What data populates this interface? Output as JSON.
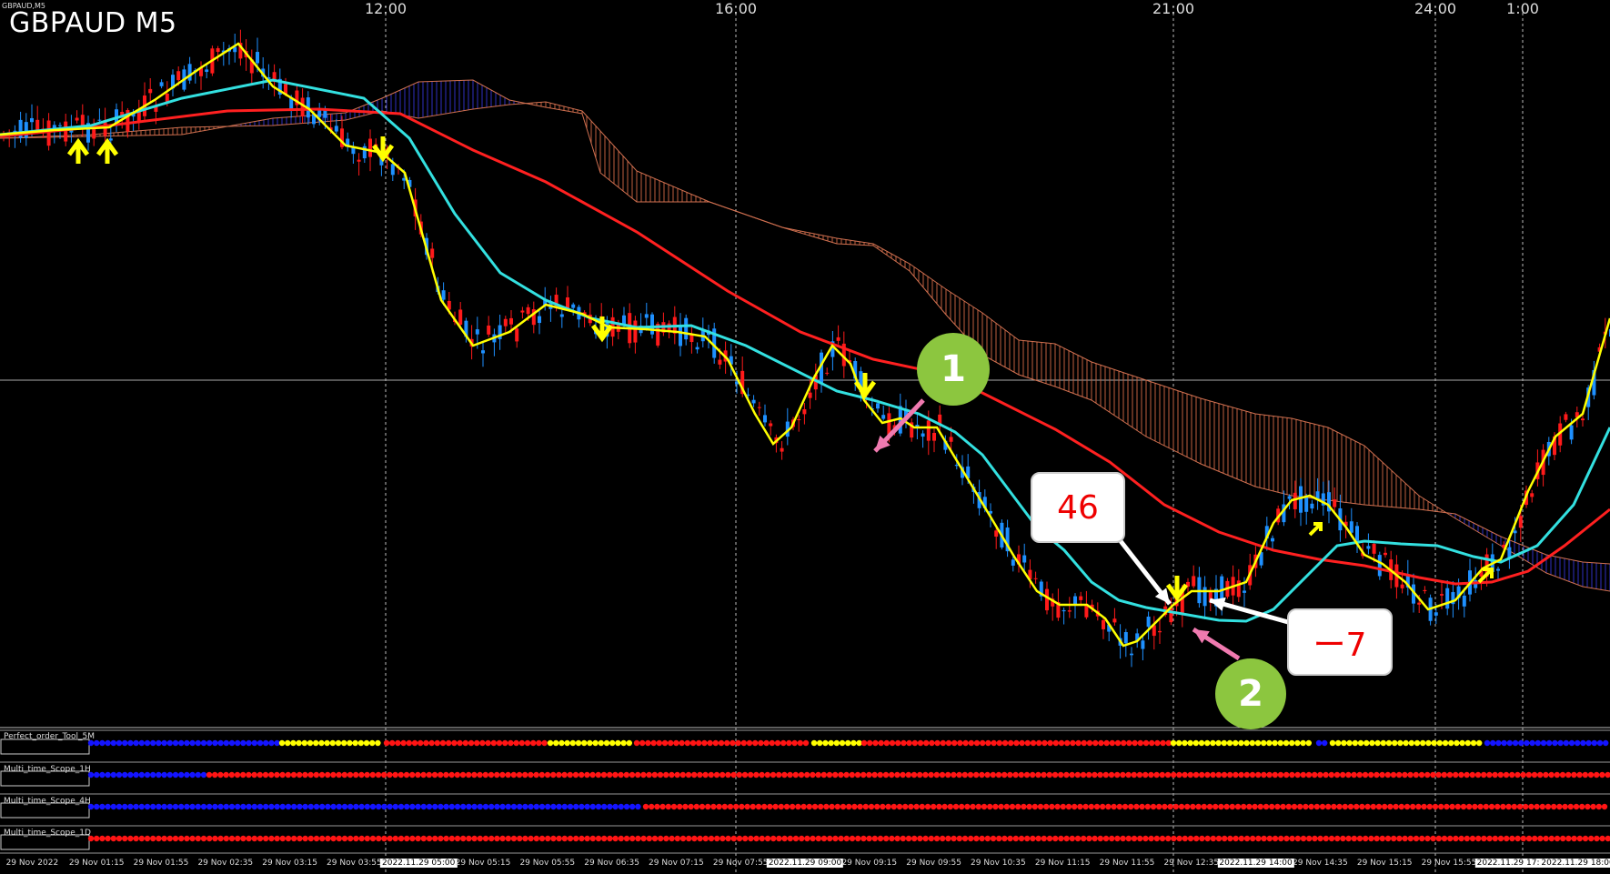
{
  "header": {
    "title": "GBPAUD M5",
    "small_title": "GBPAUD,M5"
  },
  "time_axis": [
    "12:00",
    "16:00",
    "21:00",
    "24:00",
    "1:00"
  ],
  "indicators": [
    {
      "label": "Perfect_order_Tool_5M"
    },
    {
      "label": "Multi_time_Scope_1H"
    },
    {
      "label": "Multi_time_Scope_4H"
    },
    {
      "label": "Multi_time_Scope_1D"
    }
  ],
  "bottom_axis": [
    "29 Nov 2022",
    "29 Nov 01:15",
    "29 Nov 01:55",
    "29 Nov 02:35",
    "29 Nov 03:15",
    "29 Nov 03:55",
    "2022.11.29 05:00",
    "29 Nov 05:15",
    "29 Nov 05:55",
    "29 Nov 06:35",
    "29 Nov 07:15",
    "29 Nov 07:55",
    "2022.11.29 09:00",
    "29 Nov 09:15",
    "29 Nov 09:55",
    "29 Nov 10:35",
    "29 Nov 11:15",
    "29 Nov 11:55",
    "29 Nov 12:35",
    "2022.11.29 14:00",
    "29 Nov 14:35",
    "29 Nov 15:15",
    "29 Nov 15:55",
    "2022.11.29 17:00",
    "2022.11.29 18:00"
  ],
  "annotations": {
    "bubble_1": "46",
    "bubble_2": "ー7",
    "circle_1": "1",
    "circle_2": "2"
  },
  "colors": {
    "background": "#000000",
    "bull_candle": "#1e90ff",
    "bear_candle": "#ff1a1a",
    "ma_fast": "#ffff00",
    "ma_mid": "#33e0e0",
    "ma_slow": "#ff2020",
    "cloud_bull": "#3030c0",
    "cloud_bear": "#c06040",
    "signal_arrow": "#ffff00",
    "annotation_green": "#8cc63f",
    "annotation_pink": "#f07ab0"
  }
}
